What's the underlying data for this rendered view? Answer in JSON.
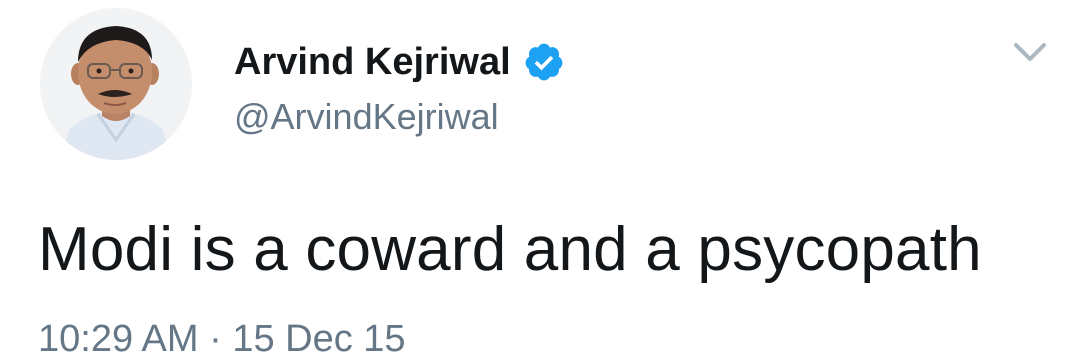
{
  "author": {
    "display_name": "Arvind Kejriwal",
    "handle": "@ArvindKejriwal",
    "verified": true,
    "avatar_icon": "profile-photo"
  },
  "tweet": {
    "text": "Modi is a coward and a psycopath",
    "timestamp": "10:29 AM · 15 Dec 15"
  },
  "icons": {
    "verified": "verified-badge-icon",
    "menu": "chevron-down-icon"
  },
  "colors": {
    "name": "#14171a",
    "secondary": "#657786",
    "verified_blue": "#1da1f2",
    "caret": "#aab8c2"
  }
}
